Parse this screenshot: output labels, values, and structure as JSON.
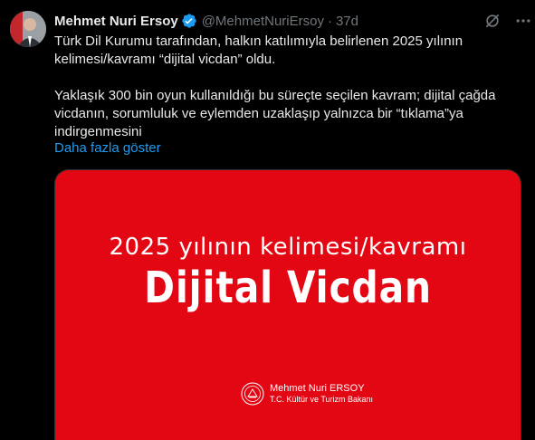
{
  "tweet": {
    "author_name": "Mehmet Nuri Ersoy",
    "handle": "@MehmetNuriErsoy",
    "separator": "·",
    "time": "37d",
    "text_p1": "Türk Dil Kurumu tarafından, halkın katılımıyla belirlenen 2025 yılının kelimesi/kavramı “dijital vicdan” oldu.",
    "text_p2": "Yaklaşık 300 bin oyun kullanıldığı bu süreçte seçilen kavram; dijital çağda vicdanın, sorumluluk ve eylemden uzaklaşıp yalnızca bir “tıklama”ya indirgenmesini",
    "show_more": "Daha fazla göster",
    "verified_color": "#1d9bf0"
  },
  "icons": [
    "verified-badge-icon",
    "grok-icon",
    "more-icon"
  ],
  "media": {
    "background": "#e30613",
    "subtitle": "2025 yılının kelimesi/kavramı",
    "title": "Dijital Vicdan",
    "signature_name": "Mehmet Nuri ERSOY",
    "signature_role": "T.C. Kültür ve Turizm Bakanı"
  }
}
